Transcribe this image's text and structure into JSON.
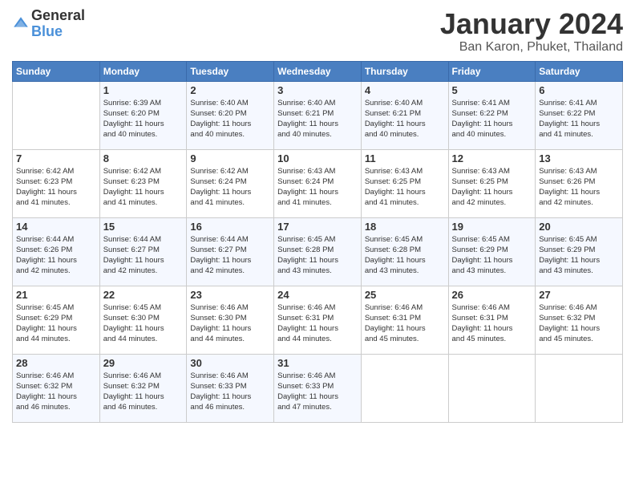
{
  "logo": {
    "general": "General",
    "blue": "Blue"
  },
  "title": "January 2024",
  "location": "Ban Karon, Phuket, Thailand",
  "days_of_week": [
    "Sunday",
    "Monday",
    "Tuesday",
    "Wednesday",
    "Thursday",
    "Friday",
    "Saturday"
  ],
  "weeks": [
    [
      {
        "day": "",
        "info": ""
      },
      {
        "day": "1",
        "info": "Sunrise: 6:39 AM\nSunset: 6:20 PM\nDaylight: 11 hours\nand 40 minutes."
      },
      {
        "day": "2",
        "info": "Sunrise: 6:40 AM\nSunset: 6:20 PM\nDaylight: 11 hours\nand 40 minutes."
      },
      {
        "day": "3",
        "info": "Sunrise: 6:40 AM\nSunset: 6:21 PM\nDaylight: 11 hours\nand 40 minutes."
      },
      {
        "day": "4",
        "info": "Sunrise: 6:40 AM\nSunset: 6:21 PM\nDaylight: 11 hours\nand 40 minutes."
      },
      {
        "day": "5",
        "info": "Sunrise: 6:41 AM\nSunset: 6:22 PM\nDaylight: 11 hours\nand 40 minutes."
      },
      {
        "day": "6",
        "info": "Sunrise: 6:41 AM\nSunset: 6:22 PM\nDaylight: 11 hours\nand 41 minutes."
      }
    ],
    [
      {
        "day": "7",
        "info": "Sunrise: 6:42 AM\nSunset: 6:23 PM\nDaylight: 11 hours\nand 41 minutes."
      },
      {
        "day": "8",
        "info": "Sunrise: 6:42 AM\nSunset: 6:23 PM\nDaylight: 11 hours\nand 41 minutes."
      },
      {
        "day": "9",
        "info": "Sunrise: 6:42 AM\nSunset: 6:24 PM\nDaylight: 11 hours\nand 41 minutes."
      },
      {
        "day": "10",
        "info": "Sunrise: 6:43 AM\nSunset: 6:24 PM\nDaylight: 11 hours\nand 41 minutes."
      },
      {
        "day": "11",
        "info": "Sunrise: 6:43 AM\nSunset: 6:25 PM\nDaylight: 11 hours\nand 41 minutes."
      },
      {
        "day": "12",
        "info": "Sunrise: 6:43 AM\nSunset: 6:25 PM\nDaylight: 11 hours\nand 42 minutes."
      },
      {
        "day": "13",
        "info": "Sunrise: 6:43 AM\nSunset: 6:26 PM\nDaylight: 11 hours\nand 42 minutes."
      }
    ],
    [
      {
        "day": "14",
        "info": "Sunrise: 6:44 AM\nSunset: 6:26 PM\nDaylight: 11 hours\nand 42 minutes."
      },
      {
        "day": "15",
        "info": "Sunrise: 6:44 AM\nSunset: 6:27 PM\nDaylight: 11 hours\nand 42 minutes."
      },
      {
        "day": "16",
        "info": "Sunrise: 6:44 AM\nSunset: 6:27 PM\nDaylight: 11 hours\nand 42 minutes."
      },
      {
        "day": "17",
        "info": "Sunrise: 6:45 AM\nSunset: 6:28 PM\nDaylight: 11 hours\nand 43 minutes."
      },
      {
        "day": "18",
        "info": "Sunrise: 6:45 AM\nSunset: 6:28 PM\nDaylight: 11 hours\nand 43 minutes."
      },
      {
        "day": "19",
        "info": "Sunrise: 6:45 AM\nSunset: 6:29 PM\nDaylight: 11 hours\nand 43 minutes."
      },
      {
        "day": "20",
        "info": "Sunrise: 6:45 AM\nSunset: 6:29 PM\nDaylight: 11 hours\nand 43 minutes."
      }
    ],
    [
      {
        "day": "21",
        "info": "Sunrise: 6:45 AM\nSunset: 6:29 PM\nDaylight: 11 hours\nand 44 minutes."
      },
      {
        "day": "22",
        "info": "Sunrise: 6:45 AM\nSunset: 6:30 PM\nDaylight: 11 hours\nand 44 minutes."
      },
      {
        "day": "23",
        "info": "Sunrise: 6:46 AM\nSunset: 6:30 PM\nDaylight: 11 hours\nand 44 minutes."
      },
      {
        "day": "24",
        "info": "Sunrise: 6:46 AM\nSunset: 6:31 PM\nDaylight: 11 hours\nand 44 minutes."
      },
      {
        "day": "25",
        "info": "Sunrise: 6:46 AM\nSunset: 6:31 PM\nDaylight: 11 hours\nand 45 minutes."
      },
      {
        "day": "26",
        "info": "Sunrise: 6:46 AM\nSunset: 6:31 PM\nDaylight: 11 hours\nand 45 minutes."
      },
      {
        "day": "27",
        "info": "Sunrise: 6:46 AM\nSunset: 6:32 PM\nDaylight: 11 hours\nand 45 minutes."
      }
    ],
    [
      {
        "day": "28",
        "info": "Sunrise: 6:46 AM\nSunset: 6:32 PM\nDaylight: 11 hours\nand 46 minutes."
      },
      {
        "day": "29",
        "info": "Sunrise: 6:46 AM\nSunset: 6:32 PM\nDaylight: 11 hours\nand 46 minutes."
      },
      {
        "day": "30",
        "info": "Sunrise: 6:46 AM\nSunset: 6:33 PM\nDaylight: 11 hours\nand 46 minutes."
      },
      {
        "day": "31",
        "info": "Sunrise: 6:46 AM\nSunset: 6:33 PM\nDaylight: 11 hours\nand 47 minutes."
      },
      {
        "day": "",
        "info": ""
      },
      {
        "day": "",
        "info": ""
      },
      {
        "day": "",
        "info": ""
      }
    ]
  ]
}
